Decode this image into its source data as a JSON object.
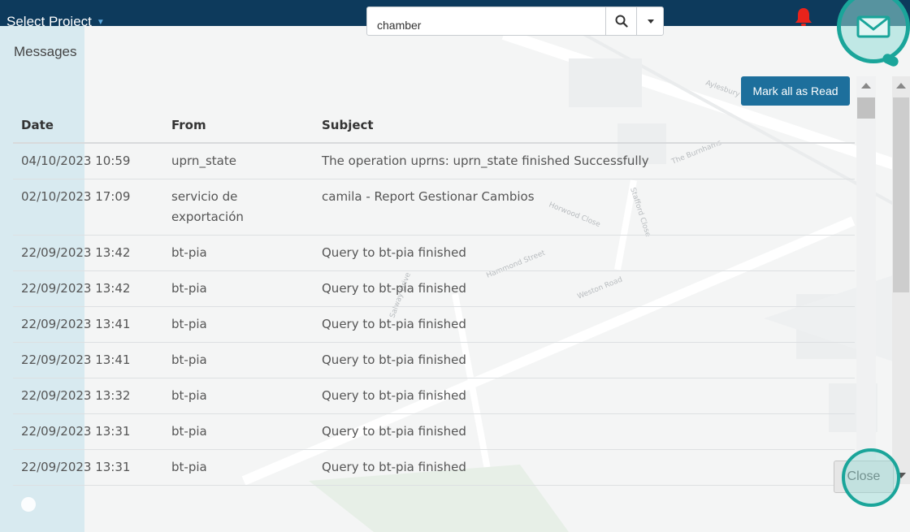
{
  "header": {
    "project_label": "Select Project",
    "search_value": "chamber"
  },
  "modal": {
    "title": "Messages",
    "mark_all_read_label": "Mark all as Read",
    "close_label": "Close"
  },
  "table": {
    "columns": [
      "Date",
      "From",
      "Subject"
    ],
    "rows": [
      {
        "date": "04/10/2023 10:59",
        "from": "uprn_state",
        "subject": "The operation uprns: uprn_state finished Successfully"
      },
      {
        "date": "02/10/2023 17:09",
        "from": "servicio de exportación",
        "subject": "camila - Report Gestionar Cambios"
      },
      {
        "date": "22/09/2023 13:42",
        "from": "bt-pia",
        "subject": "Query to bt-pia finished"
      },
      {
        "date": "22/09/2023 13:42",
        "from": "bt-pia",
        "subject": "Query to bt-pia finished"
      },
      {
        "date": "22/09/2023 13:41",
        "from": "bt-pia",
        "subject": "Query to bt-pia finished"
      },
      {
        "date": "22/09/2023 13:41",
        "from": "bt-pia",
        "subject": "Query to bt-pia finished"
      },
      {
        "date": "22/09/2023 13:32",
        "from": "bt-pia",
        "subject": "Query to bt-pia finished"
      },
      {
        "date": "22/09/2023 13:31",
        "from": "bt-pia",
        "subject": "Query to bt-pia finished"
      },
      {
        "date": "22/09/2023 13:31",
        "from": "bt-pia",
        "subject": "Query to bt-pia finished"
      }
    ]
  },
  "map_labels": [
    "Aylesbury",
    "The Burnhams",
    "Horwood Close",
    "Stafford Close",
    "Hammond Street",
    "Weston Road",
    "Salway Drive"
  ],
  "icons": {
    "search": "search-icon",
    "dropdown": "chevron-down-icon",
    "bell": "bell-icon",
    "mail": "envelope-icon"
  },
  "colors": {
    "topbar": "#0d3a5c",
    "accent": "#1d6f9c",
    "highlight_ring": "#1aa59a",
    "bell": "#e8231b"
  }
}
